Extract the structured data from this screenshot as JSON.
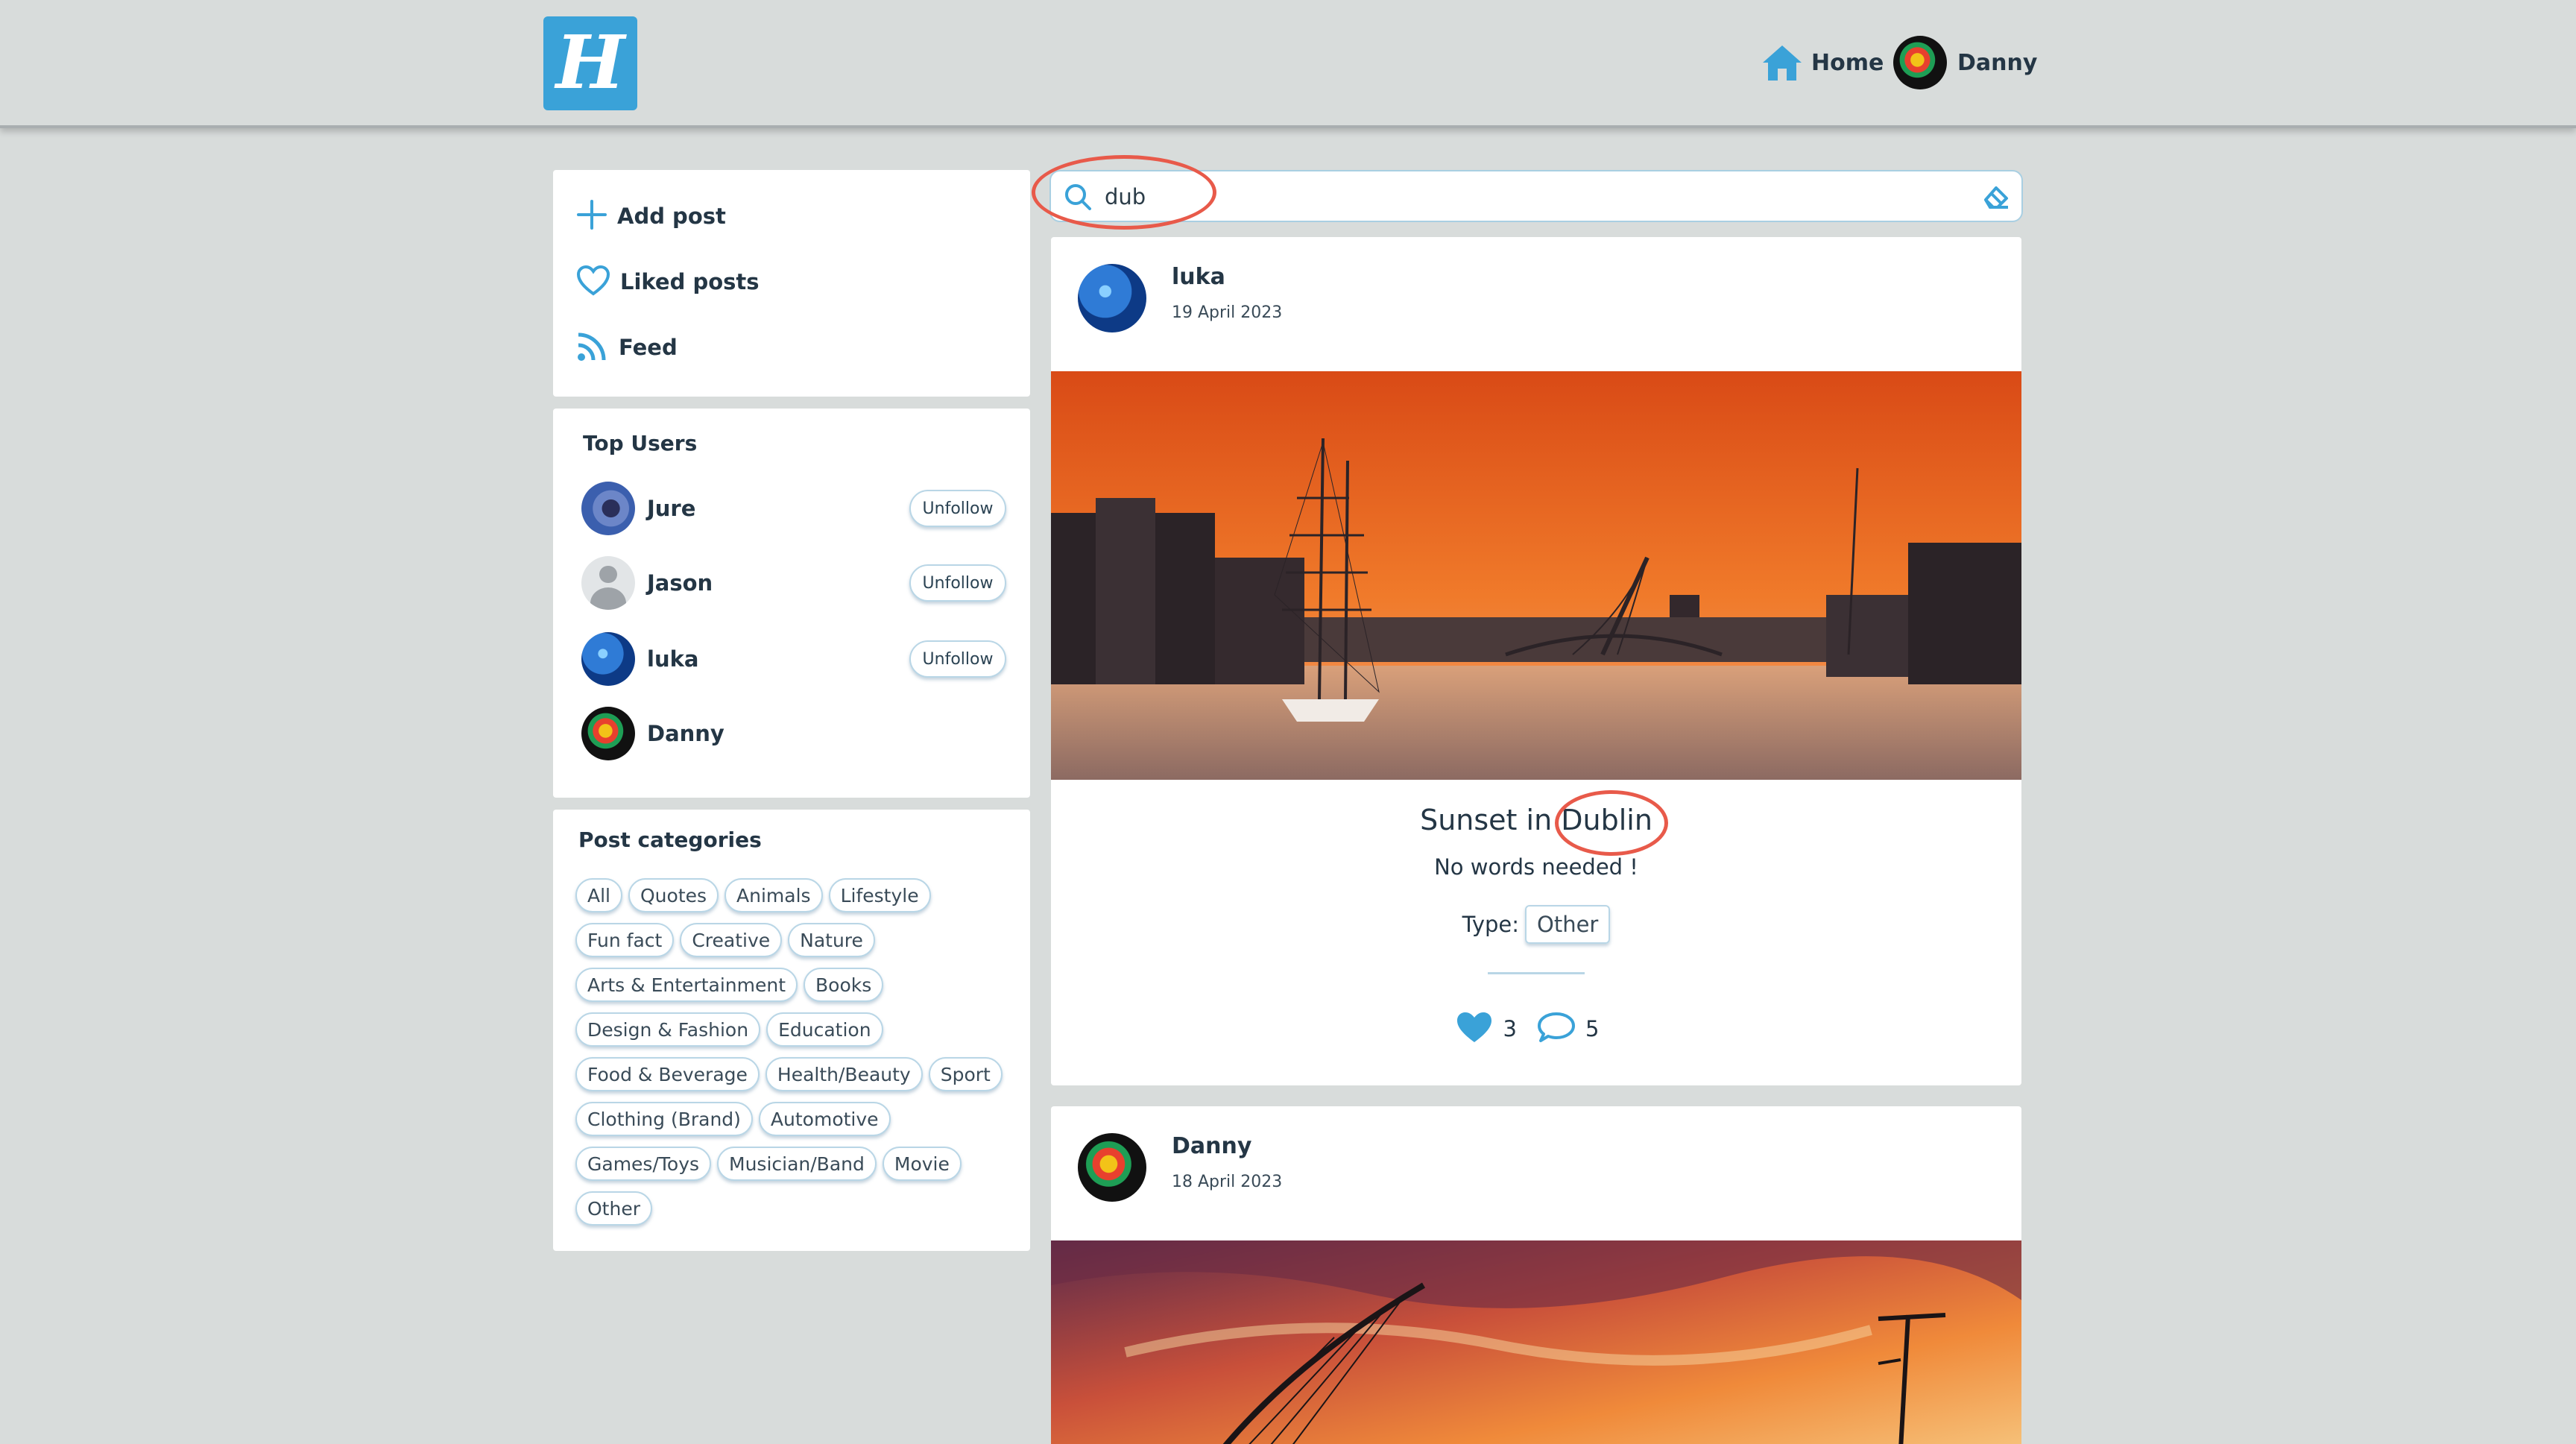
{
  "app": {
    "logo_letter": "H",
    "accent": "#3aa2d8"
  },
  "header": {
    "home_label": "Home",
    "user_label": "Danny"
  },
  "menu": {
    "items": [
      {
        "label": "Add post",
        "icon": "plus-icon"
      },
      {
        "label": "Liked posts",
        "icon": "heart-icon"
      },
      {
        "label": "Feed",
        "icon": "rss-icon"
      }
    ]
  },
  "top_users": {
    "title": "Top Users",
    "users": [
      {
        "name": "Jure",
        "action": "Unfollow"
      },
      {
        "name": "Jason",
        "action": "Unfollow"
      },
      {
        "name": "luka",
        "action": "Unfollow"
      },
      {
        "name": "Danny",
        "action": ""
      }
    ]
  },
  "categories": {
    "title": "Post categories",
    "items": [
      "All",
      "Quotes",
      "Animals",
      "Lifestyle",
      "Fun fact",
      "Creative",
      "Nature",
      "Arts & Entertainment",
      "Books",
      "Design & Fashion",
      "Education",
      "Food & Beverage",
      "Health/Beauty",
      "Sport",
      "Clothing (Brand)",
      "Automotive",
      "Games/Toys",
      "Musician/Band",
      "Movie",
      "Other"
    ]
  },
  "search": {
    "value": "dub",
    "placeholder": ""
  },
  "posts": [
    {
      "author": "luka",
      "date": "19 April 2023",
      "title_prefix": "Sunset in ",
      "title_highlight": "Dublin",
      "text": "No words needed !",
      "type_label": "Type:",
      "type_value": "Other",
      "likes": "3",
      "comments": "5"
    },
    {
      "author": "Danny",
      "date": "18 April 2023"
    }
  ]
}
